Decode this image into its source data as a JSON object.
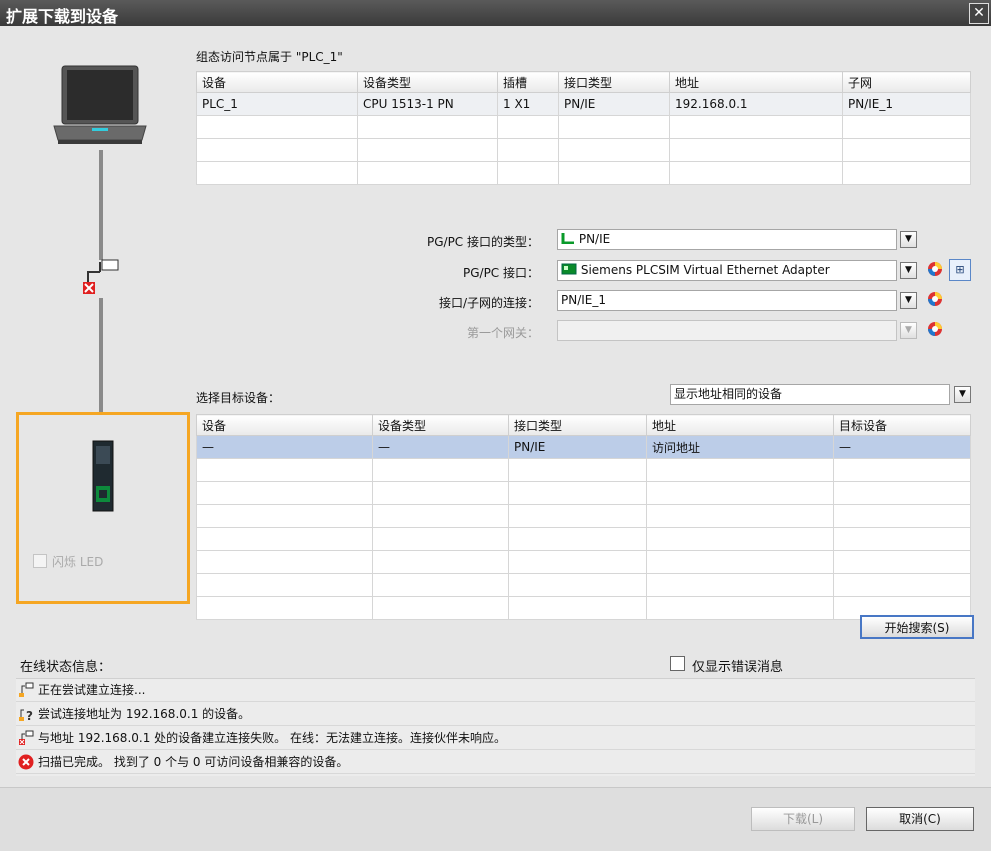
{
  "window": {
    "title": "扩展下载到设备",
    "close_label": "✕"
  },
  "config_section": {
    "heading": "组态访问节点属于 \"PLC_1\"",
    "columns": [
      "设备",
      "设备类型",
      "插槽",
      "接口类型",
      "地址",
      "子网"
    ],
    "rows": [
      [
        "PLC_1",
        "CPU 1513-1 PN",
        "1 X1",
        "PN/IE",
        "192.168.0.1",
        "PN/IE_1"
      ]
    ]
  },
  "settings": {
    "interface_type_label": "PG/PC 接口的类型：",
    "interface_type_value": "PN/IE",
    "interface_label": "PG/PC 接口：",
    "interface_value": "Siemens PLCSIM Virtual Ethernet Adapter",
    "subnet_label": "接口/子网的连接：",
    "subnet_value": "PN/IE_1",
    "gateway_label": "第一个网关：",
    "gateway_value": ""
  },
  "target_section": {
    "heading": "选择目标设备：",
    "filter_value": "显示地址相同的设备",
    "columns": [
      "设备",
      "设备类型",
      "接口类型",
      "地址",
      "目标设备"
    ],
    "rows": [
      [
        "—",
        "—",
        "PN/IE",
        "访问地址",
        "—"
      ]
    ]
  },
  "led": {
    "label": "闪烁 LED",
    "checked": false
  },
  "search_button": "开始搜索(S)",
  "status": {
    "heading": "在线状态信息：",
    "errors_only_label": "仅显示错误消息",
    "messages": [
      {
        "icon": "connecting-icon",
        "text": "正在尝试建立连接..."
      },
      {
        "icon": "query-connection-icon",
        "text": "尝试连接地址为 192.168.0.1 的设备。"
      },
      {
        "icon": "connection-failed-icon",
        "text": "与地址 192.168.0.1 处的设备建立连接失败。 在线：无法建立连接。连接伙伴未响应。"
      },
      {
        "icon": "error-icon",
        "text": "扫描已完成。 找到了 0 个与 0 可访问设备相兼容的设备。"
      }
    ]
  },
  "footer": {
    "download_label": "下载(L)",
    "cancel_label": "取消(C)"
  },
  "colors": {
    "accent": "#f5a623",
    "selection": "#bccde8",
    "error": "#e02020",
    "focus": "#4877c5"
  }
}
